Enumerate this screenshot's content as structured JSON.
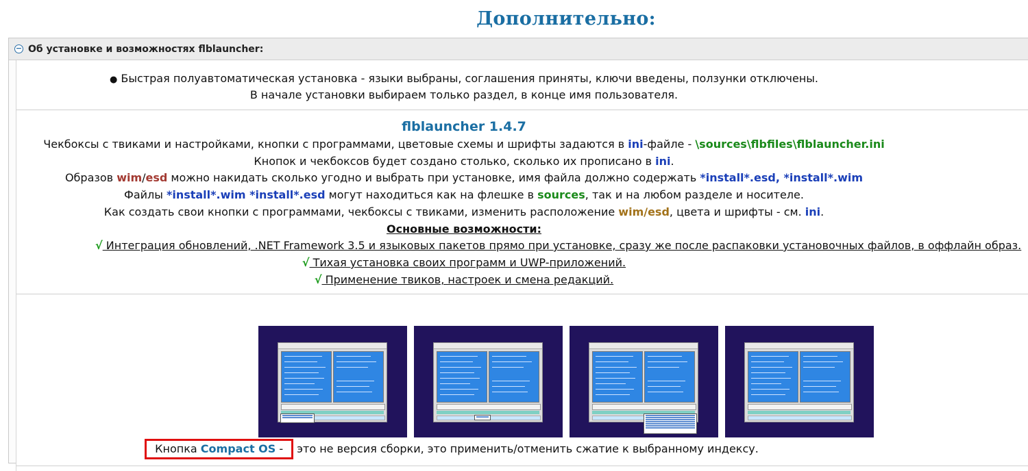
{
  "page": {
    "title": "Дополнительно:"
  },
  "spoiler": {
    "title": "Об установке и возможностях flblauncher:",
    "toggle": "−"
  },
  "intro": {
    "bullet": "●",
    "line1": "Быстрая полуавтоматическая установка - языки выбраны, соглашения приняты, ключи введены, ползунки отключены.",
    "line2": "В начале установки выбираем только раздел, в конце имя пользователя."
  },
  "flb": {
    "version": "flblauncher 1.4.7",
    "l1_a": "Чекбоксы с твиками и настройками, кнопки с программами, цветовые схемы и шрифты задаются в ",
    "l1_ini": "ini",
    "l1_b": "-файле - ",
    "l1_path": "\\sources\\flbfiles\\flblauncher.ini",
    "l2_a": "Кнопок и чекбоксов будет создано столько, сколько их прописано в ",
    "l2_ini": "ini",
    "l2_b": ".",
    "l3_a": "Образов ",
    "l3_wim": "wim",
    "l3_slash": "/",
    "l3_esd": "esd",
    "l3_b": " можно накидать сколько угодно и выбрать при установке, имя файла должно содержать ",
    "l3_pat": "*install*.esd, *install*.wim",
    "l4_a": "Файлы ",
    "l4_pat": "*install*.wim *install*.esd",
    "l4_b": " могут находиться как на флешке в ",
    "l4_src": "sources",
    "l4_c": ", так и на любом разделе и носителе.",
    "l5_a": "Как создать свои кнопки с программами, чекбоксы с твиками, изменить расположение ",
    "l5_wimesd": "wim/esd",
    "l5_b": ", цвета и шрифты - см. ",
    "l5_ini": "ini",
    "l5_c": ".",
    "features_title": "Основные возможности:",
    "check": "√",
    "f1": " Интеграция обновлений, .NET Framework 3.5 и языковых пакетов прямо при установке, сразу же после распаковки установочных файлов, в оффлайн образ.",
    "f2": " Тихая установка своих программ и UWP-приложений.",
    "f3": " Применение твиков, настроек и смена редакций."
  },
  "caption": {
    "prefix": "Кнопка ",
    "highlight": "Compact OS",
    "dash": " -",
    "rest": " это не версия сборки, это применить/отменить сжатие к выбранному индексу."
  },
  "colors": {
    "title_blue": "#1a6ea3",
    "link_blue": "#1a3fb8",
    "path_green": "#1a8a1a",
    "wim_red": "#a33a32",
    "wimesd_olive": "#a2721a",
    "screenshot_bg": "#21135c",
    "frame_red": "#e01010"
  }
}
